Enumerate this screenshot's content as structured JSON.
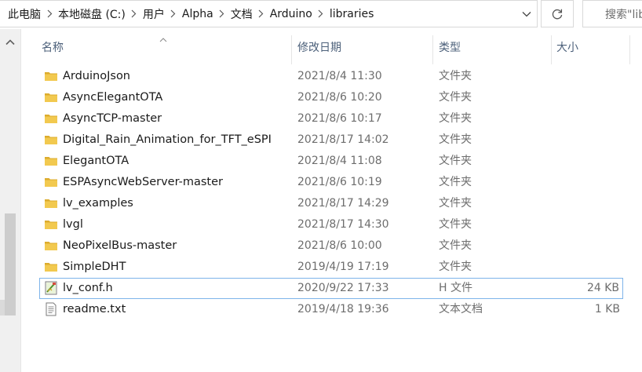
{
  "address_bar": {
    "crumbs": [
      "此电脑",
      "本地磁盘 (C:)",
      "用户",
      "Alpha",
      "文档",
      "Arduino",
      "libraries"
    ]
  },
  "search": {
    "placeholder": "搜索\"libraries\""
  },
  "columns": {
    "name": "名称",
    "date": "修改日期",
    "type": "类型",
    "size": "大小"
  },
  "files": [
    {
      "name": "ArduinoJson",
      "date": "2021/8/4 11:30",
      "type": "文件夹",
      "size": "",
      "icon": "folder-icon"
    },
    {
      "name": "AsyncElegantOTA",
      "date": "2021/8/6 10:20",
      "type": "文件夹",
      "size": "",
      "icon": "folder-icon"
    },
    {
      "name": "AsyncTCP-master",
      "date": "2021/8/6 10:17",
      "type": "文件夹",
      "size": "",
      "icon": "folder-icon"
    },
    {
      "name": "Digital_Rain_Animation_for_TFT_eSPI",
      "date": "2021/8/17 14:02",
      "type": "文件夹",
      "size": "",
      "icon": "folder-icon"
    },
    {
      "name": "ElegantOTA",
      "date": "2021/8/4 11:08",
      "type": "文件夹",
      "size": "",
      "icon": "folder-icon"
    },
    {
      "name": "ESPAsyncWebServer-master",
      "date": "2021/8/6 10:19",
      "type": "文件夹",
      "size": "",
      "icon": "folder-icon"
    },
    {
      "name": "lv_examples",
      "date": "2021/8/17 14:29",
      "type": "文件夹",
      "size": "",
      "icon": "folder-icon"
    },
    {
      "name": "lvgl",
      "date": "2021/8/17 14:30",
      "type": "文件夹",
      "size": "",
      "icon": "folder-icon"
    },
    {
      "name": "NeoPixelBus-master",
      "date": "2021/8/6 10:00",
      "type": "文件夹",
      "size": "",
      "icon": "folder-icon"
    },
    {
      "name": "SimpleDHT",
      "date": "2019/4/19 17:19",
      "type": "文件夹",
      "size": "",
      "icon": "folder-icon"
    },
    {
      "name": "lv_conf.h",
      "date": "2020/9/22 17:33",
      "type": "H 文件",
      "size": "24 KB",
      "icon": "header-file-icon",
      "selected": true
    },
    {
      "name": "readme.txt",
      "date": "2019/4/18 19:36",
      "type": "文本文档",
      "size": "1 KB",
      "icon": "text-file-icon"
    }
  ],
  "colors": {
    "folder": "#f0c451",
    "header_text": "#4c607a",
    "selection_border": "#7eb4ea"
  }
}
